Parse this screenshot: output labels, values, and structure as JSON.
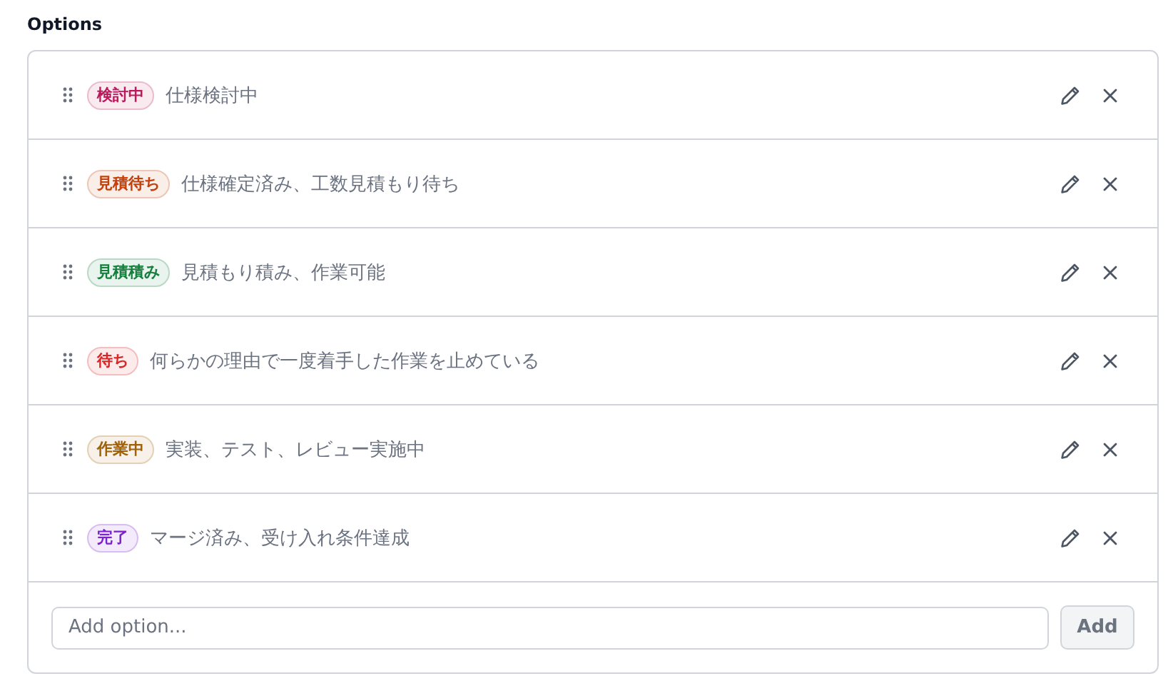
{
  "section_title": "Options",
  "options": [
    {
      "tag": "検討中",
      "color": "#be185d",
      "description": "仕様検討中"
    },
    {
      "tag": "見積待ち",
      "color": "#c2410c",
      "description": "仕様確定済み、工数見積もり待ち"
    },
    {
      "tag": "見積積み",
      "color": "#15803d",
      "description": "見積もり積み、作業可能"
    },
    {
      "tag": "待ち",
      "color": "#dc2626",
      "description": "何らかの理由で一度着手した作業を止めている"
    },
    {
      "tag": "作業中",
      "color": "#a16207",
      "description": "実装、テスト、レビュー実施中"
    },
    {
      "tag": "完了",
      "color": "#7e22ce",
      "description": "マージ済み、受け入れ条件達成"
    }
  ],
  "new_option": {
    "placeholder": "Add option..."
  },
  "add_button": {
    "label": "Add",
    "disabled": true
  }
}
